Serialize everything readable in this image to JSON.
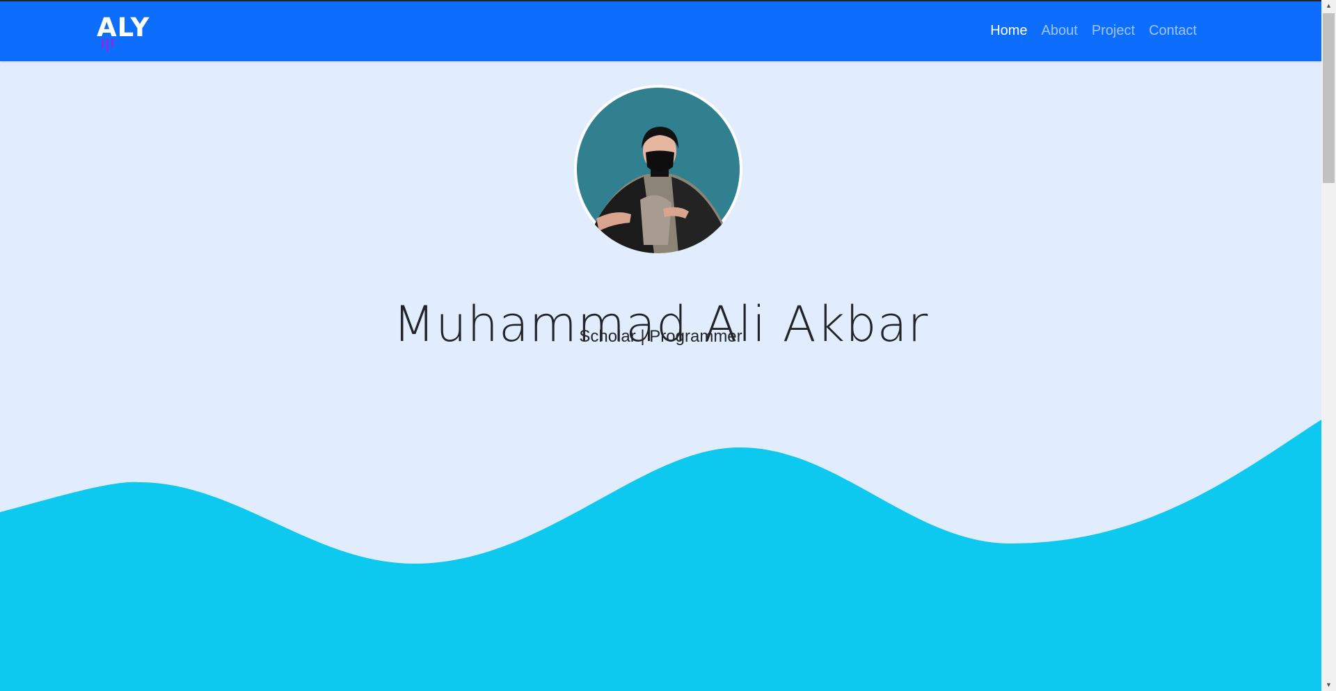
{
  "brand": {
    "name": "ALY",
    "logo": "aly-logo"
  },
  "nav": [
    {
      "label": "Home",
      "active": true
    },
    {
      "label": "About",
      "active": false
    },
    {
      "label": "Project",
      "active": false
    },
    {
      "label": "Contact",
      "active": false
    }
  ],
  "hero": {
    "name": "Muhammad Ali Akbar",
    "tagline": "Scholar | Programmer",
    "avatar": "profile-avatar"
  },
  "colors": {
    "navbar": "#0d6efd",
    "background": "#e1edfd",
    "wave": "#0dc8ef",
    "avatar_bg": "#31808f",
    "logo_accent": "#8a2be2"
  },
  "scrollbar": {
    "up": "up-arrow-icon",
    "down": "down-arrow-icon"
  }
}
